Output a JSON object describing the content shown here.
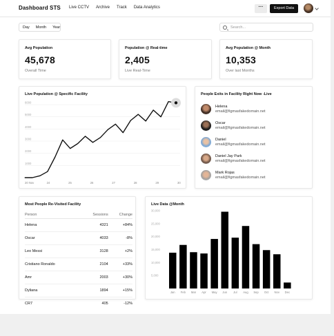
{
  "header": {
    "logo": "Dashboard STS",
    "nav": [
      "Live CCTV",
      "Archive",
      "Track",
      "Data Analytics"
    ],
    "more_label": "···",
    "export_label": "Export Data"
  },
  "filters": {
    "periods": [
      "Day",
      "Month",
      "Year"
    ],
    "search_placeholder": "Search..."
  },
  "stats": [
    {
      "title": "Avg Population",
      "value": "45,678",
      "sub": "Overall Time"
    },
    {
      "title": "Population @ Real-time",
      "value": "2,405",
      "sub": "Live Real-Time"
    },
    {
      "title": "Avg Population @ Month",
      "value": "10,353",
      "sub": "Over last Months"
    }
  ],
  "live_population": {
    "title": "Live Population @ Specific Facility"
  },
  "people_exits": {
    "title": "People Exits in Facility Right Now -Live",
    "people": [
      {
        "name": "Helena",
        "email": "email@figmasfakedomain.net"
      },
      {
        "name": "Oscar",
        "email": "email@figmasfakedomain.net"
      },
      {
        "name": "Daniel",
        "email": "email@figmasfakedomain.net"
      },
      {
        "name": "Daniel Jay Park",
        "email": "email@figmasfakedomain.net"
      },
      {
        "name": "Mark Rojas",
        "email": "email@figmasfakedomain.net"
      }
    ]
  },
  "revisited": {
    "title": "Most People Re-Visited Facility",
    "columns": [
      "Person",
      "Sessions",
      "Change"
    ],
    "rows": [
      [
        "Helena",
        "4321",
        "+84%"
      ],
      [
        "Oscar",
        "4033",
        "-8%"
      ],
      [
        "Leo Messi",
        "3128",
        "+2%"
      ],
      [
        "Cristiano Ronaldo",
        "2104",
        "+33%"
      ],
      [
        "Amr",
        "2003",
        "+30%"
      ],
      [
        "Dyliana",
        "1894",
        "+15%"
      ],
      [
        "CR7",
        "405",
        "-12%"
      ]
    ]
  },
  "chart_data": [
    {
      "type": "line",
      "title": "Live Population @ Specific Facility",
      "x": [
        "20 Nov",
        "",
        "",
        "",
        "",
        "",
        "",
        "",
        "",
        "",
        "",
        "",
        "",
        "",
        "",
        "",
        "",
        "",
        "",
        "",
        ""
      ],
      "x_tick_labels": [
        "20 Nov",
        "24",
        "25",
        "26",
        "27",
        "28",
        "29",
        "30"
      ],
      "y_tick_labels": [
        "1000",
        "2000",
        "3000",
        "4000",
        "5000",
        "6000"
      ],
      "values": [
        0,
        0,
        150,
        500,
        1700,
        3100,
        2400,
        2800,
        3400,
        2900,
        3300,
        3950,
        4400,
        3700,
        4700,
        5200,
        4650,
        5550,
        5000,
        6250,
        6150
      ],
      "ylim": [
        0,
        6000
      ],
      "grid": true,
      "highlight_index": 20,
      "color": "#111111"
    },
    {
      "type": "bar",
      "title": "Live Data @Month",
      "categories": [
        "Jan",
        "Feb",
        "Mar",
        "Apr",
        "May",
        "Jun",
        "Jul",
        "Aug",
        "Sep",
        "Oct",
        "Nov",
        "Dec"
      ],
      "values": [
        13800,
        16800,
        14000,
        13500,
        19100,
        29600,
        19600,
        24100,
        17100,
        14800,
        13200,
        2300
      ],
      "y_tick_labels": [
        "5,000",
        "10,000",
        "15,000",
        "20,000",
        "25,000",
        "30,000"
      ],
      "ylim": [
        0,
        30000
      ],
      "grid": true,
      "color": "#000000"
    }
  ]
}
